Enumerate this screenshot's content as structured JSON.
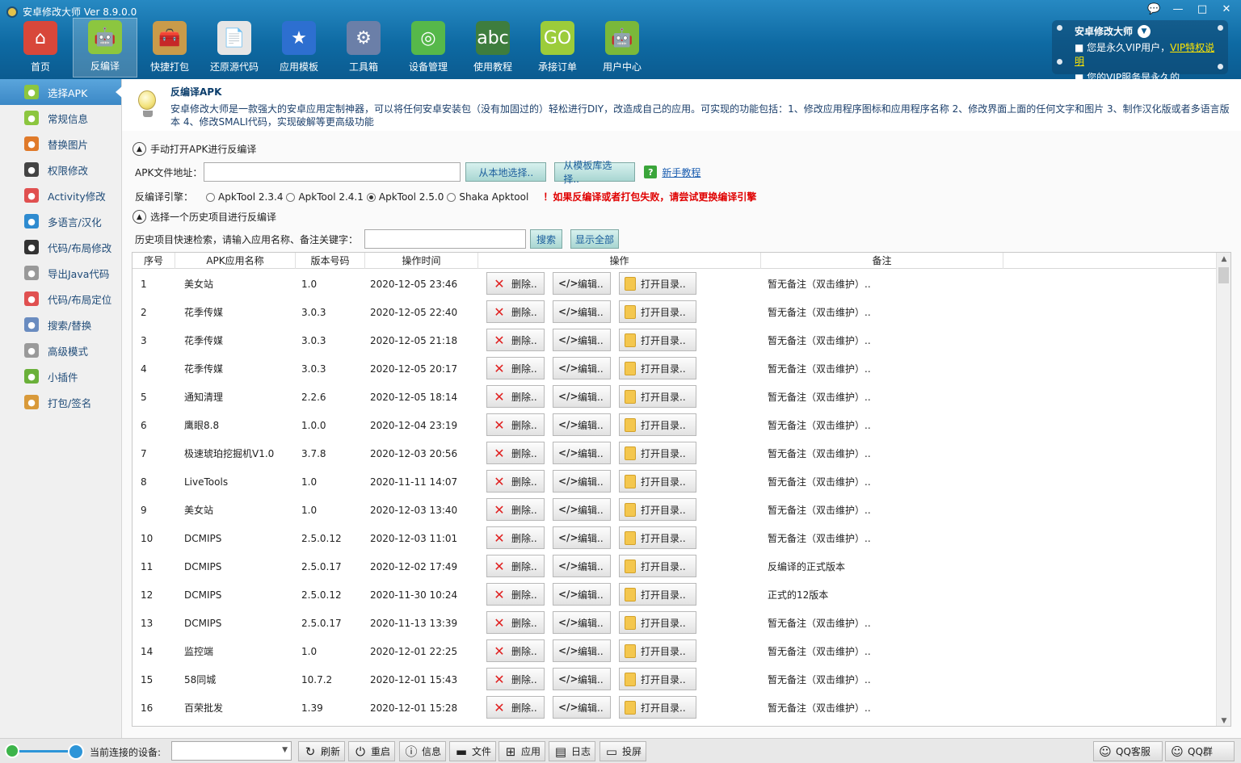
{
  "window": {
    "title": "安卓修改大师 Ver 8.9.0.0",
    "controls": [
      "💬",
      "—",
      "□",
      "✕"
    ]
  },
  "toolbar": [
    {
      "label": "首页",
      "color": "#d8473a",
      "glyph": "⌂"
    },
    {
      "label": "反编译",
      "color": "#8cc63f",
      "glyph": "🤖",
      "active": true
    },
    {
      "label": "快捷打包",
      "color": "#c99b4a",
      "glyph": "🧰"
    },
    {
      "label": "还原源代码",
      "color": "#e6e6e6",
      "glyph": "📄"
    },
    {
      "label": "应用模板",
      "color": "#2d6fd0",
      "glyph": "★"
    },
    {
      "label": "工具箱",
      "color": "#6b7fa8",
      "glyph": "⚙"
    },
    {
      "label": "设备管理",
      "color": "#56b84a",
      "glyph": "◎"
    },
    {
      "label": "使用教程",
      "color": "#3e7d3e",
      "glyph": "abc"
    },
    {
      "label": "承接订单",
      "color": "#9ccc3a",
      "glyph": "GO"
    },
    {
      "label": "用户中心",
      "color": "#7ab83a",
      "glyph": "🤖"
    }
  ],
  "vip": {
    "title": "安卓修改大师",
    "line1": "■ 您是永久VIP用户，",
    "line1_link": "VIP特权说明",
    "line2": "■ 您的VIP服务是永久的"
  },
  "sidebar": [
    {
      "label": "选择APK",
      "color": "#8cc63f",
      "active": true
    },
    {
      "label": "常规信息",
      "color": "#8cc63f"
    },
    {
      "label": "替换图片",
      "color": "#e07a2a"
    },
    {
      "label": "权限修改",
      "color": "#444444"
    },
    {
      "label": "Activity修改",
      "color": "#e05050"
    },
    {
      "label": "多语言/汉化",
      "color": "#2e8bd0"
    },
    {
      "label": "代码/布局修改",
      "color": "#333333"
    },
    {
      "label": "导出Java代码",
      "color": "#999999"
    },
    {
      "label": "代码/布局定位",
      "color": "#e05050"
    },
    {
      "label": "搜索/替换",
      "color": "#6a8cc0"
    },
    {
      "label": "高级模式",
      "color": "#9a9a9a"
    },
    {
      "label": "小插件",
      "color": "#6ab03a"
    },
    {
      "label": "打包/签名",
      "color": "#d99a3a"
    }
  ],
  "header": {
    "title": "反编译APK",
    "desc": "安卓修改大师是一款强大的安卓应用定制神器，可以将任何安卓安装包（没有加固过的）轻松进行DIY，改造成自己的应用。可实现的功能包括：1、修改应用程序图标和应用程序名称 2、修改界面上面的任何文字和图片 3、制作汉化版或者多语言版本 4、修改SMALI代码，实现破解等更高级功能"
  },
  "manual": {
    "section_title": "手动打开APK进行反编译",
    "path_label": "APK文件地址：",
    "path_value": "",
    "btn_local": "从本地选择..",
    "btn_template": "从模板库选择..",
    "help_glyph": "?",
    "help_link": "新手教程",
    "engine_label": "反编译引擎：",
    "engines": [
      {
        "label": "ApkTool 2.3.4",
        "checked": false
      },
      {
        "label": "ApkTool 2.4.1",
        "checked": false
      },
      {
        "label": "ApkTool 2.5.0",
        "checked": true
      },
      {
        "label": "Shaka Apktool",
        "checked": false
      }
    ],
    "warning": "！如果反编译或者打包失败，请尝试更换编译引擎"
  },
  "history": {
    "section_title": "选择一个历史项目进行反编译",
    "search_label": "历史项目快速检索，请输入应用名称、备注关键字：",
    "search_value": "",
    "btn_search": "搜索",
    "btn_show_all": "显示全部"
  },
  "table": {
    "columns": [
      "序号",
      "APK应用名称",
      "版本号码",
      "操作时间",
      "操作",
      "备注"
    ],
    "action_delete": "删除..",
    "action_edit": "编辑..",
    "action_open": "打开目录..",
    "rows": [
      {
        "no": "1",
        "name": "美女站",
        "ver": "1.0",
        "time": "2020-12-05 23:46",
        "note": "暂无备注（双击维护）.."
      },
      {
        "no": "2",
        "name": "花季传媒",
        "ver": "3.0.3",
        "time": "2020-12-05 22:40",
        "note": "暂无备注（双击维护）.."
      },
      {
        "no": "3",
        "name": "花季传媒",
        "ver": "3.0.3",
        "time": "2020-12-05 21:18",
        "note": "暂无备注（双击维护）.."
      },
      {
        "no": "4",
        "name": "花季传媒",
        "ver": "3.0.3",
        "time": "2020-12-05 20:17",
        "note": "暂无备注（双击维护）.."
      },
      {
        "no": "5",
        "name": "通知清理",
        "ver": "2.2.6",
        "time": "2020-12-05 18:14",
        "note": "暂无备注（双击维护）.."
      },
      {
        "no": "6",
        "name": "鹰眼8.8",
        "ver": "1.0.0",
        "time": "2020-12-04 23:19",
        "note": "暂无备注（双击维护）.."
      },
      {
        "no": "7",
        "name": "极速琥珀挖掘机V1.0",
        "ver": "3.7.8",
        "time": "2020-12-03 20:56",
        "note": "暂无备注（双击维护）.."
      },
      {
        "no": "8",
        "name": "LiveTools",
        "ver": "1.0",
        "time": "2020-11-11 14:07",
        "note": "暂无备注（双击维护）.."
      },
      {
        "no": "9",
        "name": "美女站",
        "ver": "1.0",
        "time": "2020-12-03 13:40",
        "note": "暂无备注（双击维护）.."
      },
      {
        "no": "10",
        "name": "DCMIPS",
        "ver": "2.5.0.12",
        "time": "2020-12-03 11:01",
        "note": "暂无备注（双击维护）.."
      },
      {
        "no": "11",
        "name": "DCMIPS",
        "ver": "2.5.0.17",
        "time": "2020-12-02 17:49",
        "note": "反编译的正式版本"
      },
      {
        "no": "12",
        "name": "DCMIPS",
        "ver": "2.5.0.12",
        "time": "2020-11-30 10:24",
        "note": "正式的12版本"
      },
      {
        "no": "13",
        "name": "DCMIPS",
        "ver": "2.5.0.17",
        "time": "2020-11-13 13:39",
        "note": "暂无备注（双击维护）.."
      },
      {
        "no": "14",
        "name": "监控端",
        "ver": "1.0",
        "time": "2020-12-01 22:25",
        "note": "暂无备注（双击维护）.."
      },
      {
        "no": "15",
        "name": "58同城",
        "ver": "10.7.2",
        "time": "2020-12-01 15:43",
        "note": "暂无备注（双击维护）.."
      },
      {
        "no": "16",
        "name": "百荣批发",
        "ver": "1.39",
        "time": "2020-12-01 15:28",
        "note": "暂无备注（双击维护）.."
      }
    ]
  },
  "statusbar": {
    "device_label": "当前连接的设备:",
    "device_value": "",
    "buttons": [
      {
        "label": "刷新",
        "glyph": "↻"
      },
      {
        "label": "重启",
        "glyph": "⏻"
      },
      {
        "label": "信息",
        "glyph": "ⓘ"
      },
      {
        "label": "文件",
        "glyph": "▬"
      },
      {
        "label": "应用",
        "glyph": "⊞"
      },
      {
        "label": "日志",
        "glyph": "▤"
      },
      {
        "label": "投屏",
        "glyph": "▭"
      }
    ],
    "qq_service": "QQ客服",
    "qq_group": "QQ群"
  }
}
